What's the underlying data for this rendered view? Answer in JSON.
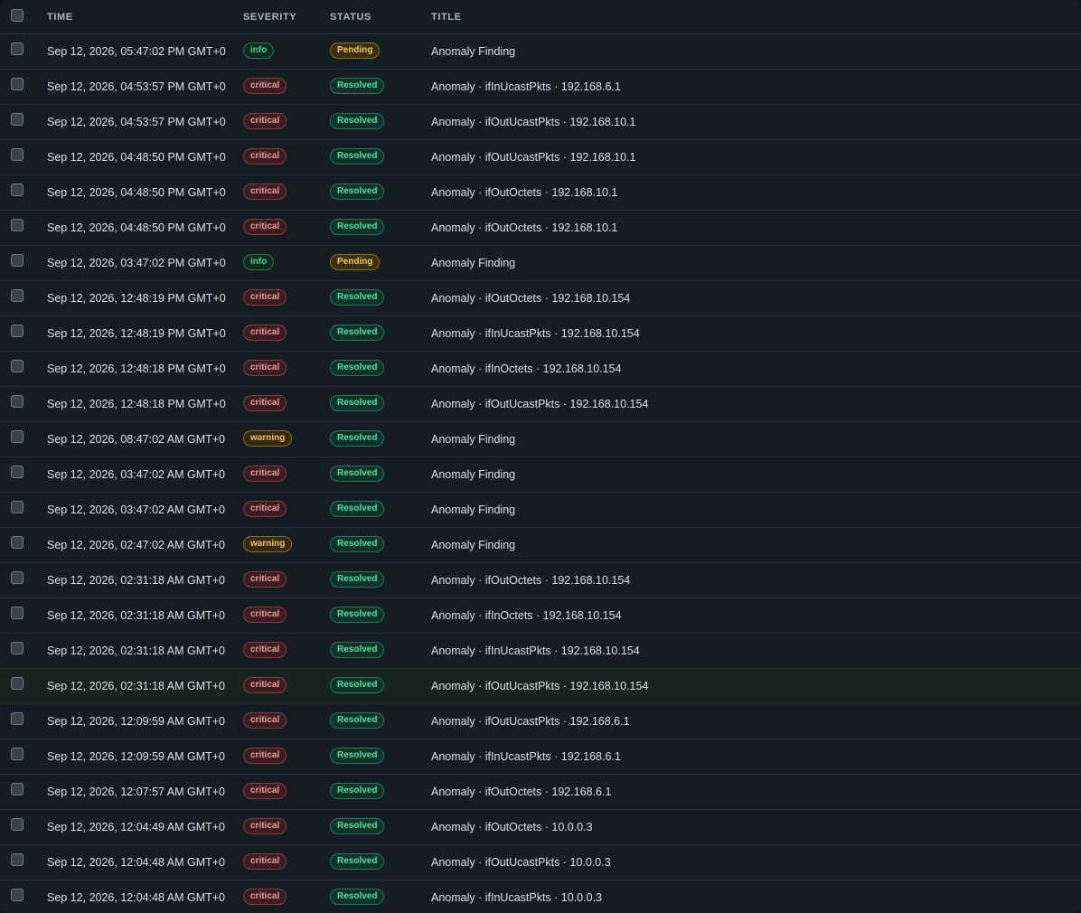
{
  "header": {
    "time": "TIME",
    "severity": "SEVERITY",
    "status": "STATUS",
    "title": "TITLE"
  },
  "colors": {
    "critical": "#f09a9a",
    "warning": "#f1c45a",
    "info": "#3fd68f",
    "pending": "#f2c75b",
    "resolved": "#4fe0a6"
  },
  "rows": [
    {
      "time": "Sep 12, 2026, 05:47:02 PM GMT+0",
      "severity": "info",
      "status": "Pending",
      "title": "Anomaly Finding"
    },
    {
      "time": "Sep 12, 2026, 04:53:57 PM GMT+0",
      "severity": "critical",
      "status": "Resolved",
      "title": "Anomaly · ifInUcastPkts · 192.168.6.1"
    },
    {
      "time": "Sep 12, 2026, 04:53:57 PM GMT+0",
      "severity": "critical",
      "status": "Resolved",
      "title": "Anomaly · ifOutUcastPkts · 192.168.10.1"
    },
    {
      "time": "Sep 12, 2026, 04:48:50 PM GMT+0",
      "severity": "critical",
      "status": "Resolved",
      "title": "Anomaly · ifOutUcastPkts · 192.168.10.1"
    },
    {
      "time": "Sep 12, 2026, 04:48:50 PM GMT+0",
      "severity": "critical",
      "status": "Resolved",
      "title": "Anomaly · ifOutOctets · 192.168.10.1"
    },
    {
      "time": "Sep 12, 2026, 04:48:50 PM GMT+0",
      "severity": "critical",
      "status": "Resolved",
      "title": "Anomaly · ifOutOctets · 192.168.10.1"
    },
    {
      "time": "Sep 12, 2026, 03:47:02 PM GMT+0",
      "severity": "info",
      "status": "Pending",
      "title": "Anomaly Finding"
    },
    {
      "time": "Sep 12, 2026, 12:48:19 PM GMT+0",
      "severity": "critical",
      "status": "Resolved",
      "title": "Anomaly · ifOutOctets · 192.168.10.154"
    },
    {
      "time": "Sep 12, 2026, 12:48:19 PM GMT+0",
      "severity": "critical",
      "status": "Resolved",
      "title": "Anomaly · ifInUcastPkts · 192.168.10.154"
    },
    {
      "time": "Sep 12, 2026, 12:48:18 PM GMT+0",
      "severity": "critical",
      "status": "Resolved",
      "title": "Anomaly · ifInOctets · 192.168.10.154"
    },
    {
      "time": "Sep 12, 2026, 12:48:18 PM GMT+0",
      "severity": "critical",
      "status": "Resolved",
      "title": "Anomaly · ifOutUcastPkts · 192.168.10.154"
    },
    {
      "time": "Sep 12, 2026, 08:47:02 AM GMT+0",
      "severity": "warning",
      "status": "Resolved",
      "title": "Anomaly Finding"
    },
    {
      "time": "Sep 12, 2026, 03:47:02 AM GMT+0",
      "severity": "critical",
      "status": "Resolved",
      "title": "Anomaly Finding"
    },
    {
      "time": "Sep 12, 2026, 03:47:02 AM GMT+0",
      "severity": "critical",
      "status": "Resolved",
      "title": "Anomaly Finding"
    },
    {
      "time": "Sep 12, 2026, 02:47:02 AM GMT+0",
      "severity": "warning",
      "status": "Resolved",
      "title": "Anomaly Finding"
    },
    {
      "time": "Sep 12, 2026, 02:31:18 AM GMT+0",
      "severity": "critical",
      "status": "Resolved",
      "title": "Anomaly · ifOutOctets · 192.168.10.154"
    },
    {
      "time": "Sep 12, 2026, 02:31:18 AM GMT+0",
      "severity": "critical",
      "status": "Resolved",
      "title": "Anomaly · ifInOctets · 192.168.10.154"
    },
    {
      "time": "Sep 12, 2026, 02:31:18 AM GMT+0",
      "severity": "critical",
      "status": "Resolved",
      "title": "Anomaly · ifInUcastPkts · 192.168.10.154"
    },
    {
      "time": "Sep 12, 2026, 02:31:18 AM GMT+0",
      "severity": "critical",
      "status": "Resolved",
      "title": "Anomaly · ifOutUcastPkts · 192.168.10.154",
      "highlighted": true
    },
    {
      "time": "Sep 12, 2026, 12:09:59 AM GMT+0",
      "severity": "critical",
      "status": "Resolved",
      "title": "Anomaly · ifOutUcastPkts · 192.168.6.1"
    },
    {
      "time": "Sep 12, 2026, 12:09:59 AM GMT+0",
      "severity": "critical",
      "status": "Resolved",
      "title": "Anomaly · ifInUcastPkts · 192.168.6.1"
    },
    {
      "time": "Sep 12, 2026, 12:07:57 AM GMT+0",
      "severity": "critical",
      "status": "Resolved",
      "title": "Anomaly · ifOutOctets · 192.168.6.1"
    },
    {
      "time": "Sep 12, 2026, 12:04:49 AM GMT+0",
      "severity": "critical",
      "status": "Resolved",
      "title": "Anomaly · ifOutOctets · 10.0.0.3"
    },
    {
      "time": "Sep 12, 2026, 12:04:48 AM GMT+0",
      "severity": "critical",
      "status": "Resolved",
      "title": "Anomaly · ifOutUcastPkts · 10.0.0.3"
    },
    {
      "time": "Sep 12, 2026, 12:04:48 AM GMT+0",
      "severity": "critical",
      "status": "Resolved",
      "title": "Anomaly · ifInUcastPkts · 10.0.0.3"
    }
  ]
}
